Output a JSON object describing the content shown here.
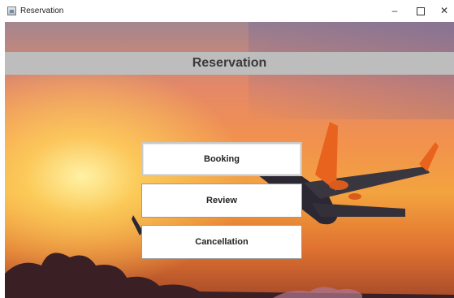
{
  "window": {
    "title": "Reservation",
    "controls": {
      "minimize": "–",
      "maximize": "□",
      "close": "✕"
    }
  },
  "header": {
    "title": "Reservation"
  },
  "menu": {
    "booking_label": "Booking",
    "review_label": "Review",
    "cancellation_label": "Cancellation"
  },
  "colors": {
    "header_band": "#bdbdbd",
    "button_bg": "#ffffff",
    "sunset_orange": "#f3a33f",
    "sky_top": "#a3868f"
  }
}
